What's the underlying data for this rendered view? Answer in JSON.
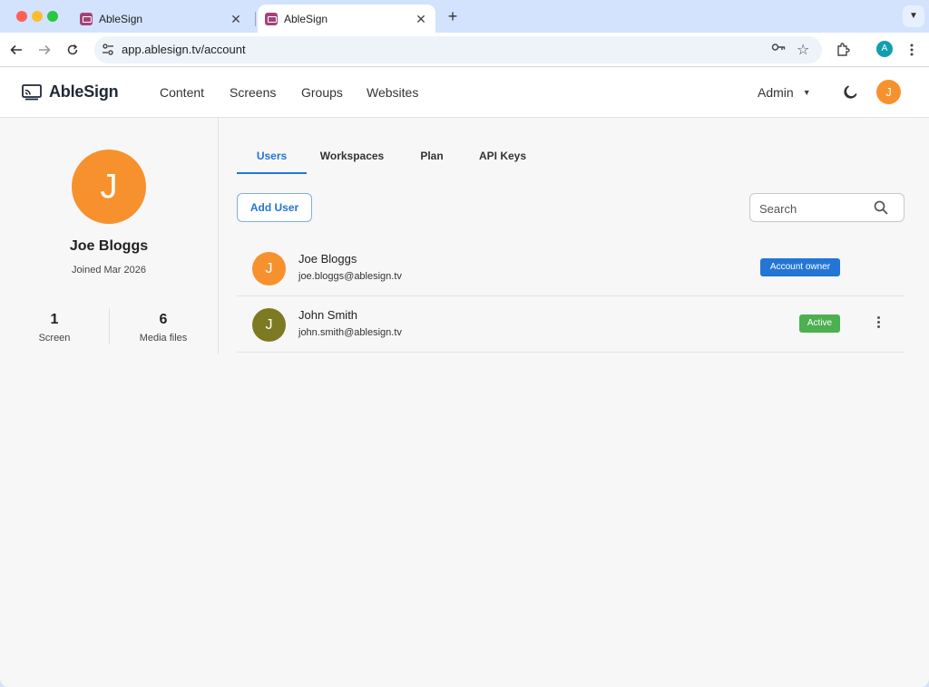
{
  "browser": {
    "tabs": [
      {
        "title": "AbleSign"
      },
      {
        "title": "AbleSign"
      }
    ],
    "url": "app.ablesign.tv/account",
    "profile_initial": "A"
  },
  "app": {
    "logo_text": "AbleSign",
    "nav": [
      "Content",
      "Screens",
      "Groups",
      "Websites"
    ],
    "role_menu": "Admin",
    "avatar_initial": "J"
  },
  "profile": {
    "initial": "J",
    "name": "Joe Bloggs",
    "joined": "Joined Mar 2026",
    "stats": [
      {
        "value": "1",
        "label": "Screen"
      },
      {
        "value": "6",
        "label": "Media files"
      }
    ]
  },
  "account_tabs": {
    "items": [
      "Users",
      "Workspaces",
      "Plan",
      "API Keys"
    ],
    "selected": "Users"
  },
  "users_panel": {
    "add_button": "Add User",
    "search_placeholder": "Search",
    "users": [
      {
        "initial": "J",
        "name": "Joe Bloggs",
        "email": "joe.bloggs@ablesign.tv",
        "badge": "Account owner",
        "badge_color": "#2376d4",
        "avatar_color": "#f7912e"
      },
      {
        "initial": "J",
        "name": "John Smith",
        "email": "john.smith@ablesign.tv",
        "badge": "Active",
        "badge_color": "#4caf50",
        "avatar_color": "#7d7a23"
      }
    ]
  },
  "colors": {
    "accent": "#2376d4",
    "orange": "#f7912e"
  }
}
